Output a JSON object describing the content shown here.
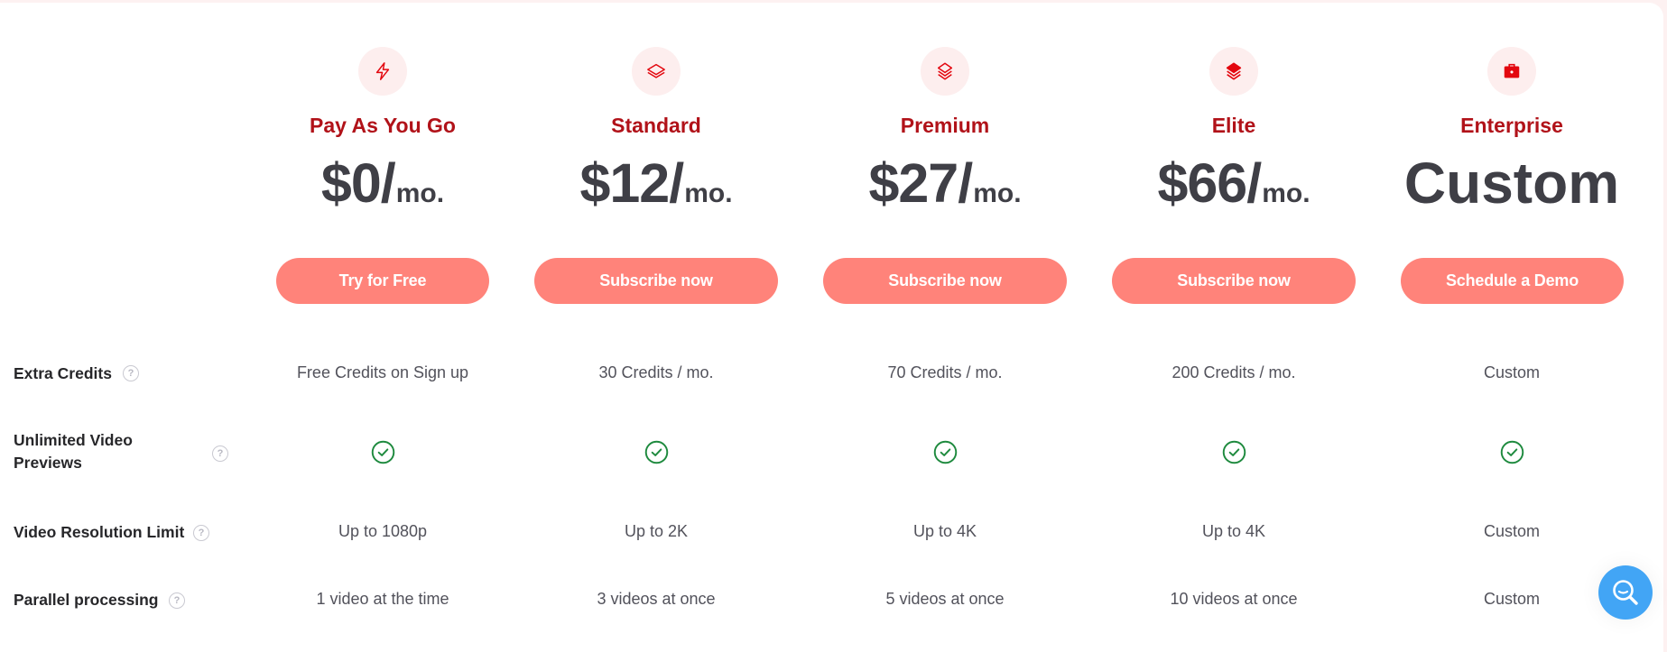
{
  "plans": [
    {
      "name": "Pay As You Go",
      "icon": "lightning-bolt-icon",
      "price_amount": "$0/",
      "price_unit": "mo.",
      "cta": "Try for Free"
    },
    {
      "name": "Standard",
      "icon": "layer-single-icon",
      "price_amount": "$12/",
      "price_unit": "mo.",
      "cta": "Subscribe now"
    },
    {
      "name": "Premium",
      "icon": "layers-stack-outline-icon",
      "price_amount": "$27/",
      "price_unit": "mo.",
      "cta": "Subscribe now"
    },
    {
      "name": "Elite",
      "icon": "layers-stack-filled-icon",
      "price_amount": "$66/",
      "price_unit": "mo.",
      "cta": "Subscribe now"
    },
    {
      "name": "Enterprise",
      "icon": "briefcase-icon",
      "price_amount": "Custom",
      "price_unit": "",
      "cta": "Schedule a Demo"
    }
  ],
  "features": [
    {
      "label": "Extra Credits",
      "values": [
        "Free Credits on Sign up",
        "30 Credits / mo.",
        "70 Credits / mo.",
        "200 Credits / mo.",
        "Custom"
      ]
    },
    {
      "label_line1": "Unlimited Video",
      "label_line2": "Previews",
      "values": [
        "check",
        "check",
        "check",
        "check",
        "check"
      ]
    },
    {
      "label": "Video Resolution Limit",
      "values": [
        "Up to 1080p",
        "Up to 2K",
        "Up to 4K",
        "Up to 4K",
        "Custom"
      ]
    },
    {
      "label": "Parallel processing",
      "values": [
        "1 video at the time",
        "3 videos at once",
        "5 videos at once",
        "10 videos at once",
        "Custom"
      ]
    }
  ],
  "help_glyph": "?",
  "colors": {
    "accent": "#b11219",
    "button": "#ff837a",
    "icon_red": "#e3070f",
    "icon_bg": "#fdeeee",
    "check_green": "#1e8a3e",
    "fab_blue": "#42a5f5",
    "price_text": "#3f3f46"
  },
  "fab": {
    "icon": "search-icon"
  }
}
